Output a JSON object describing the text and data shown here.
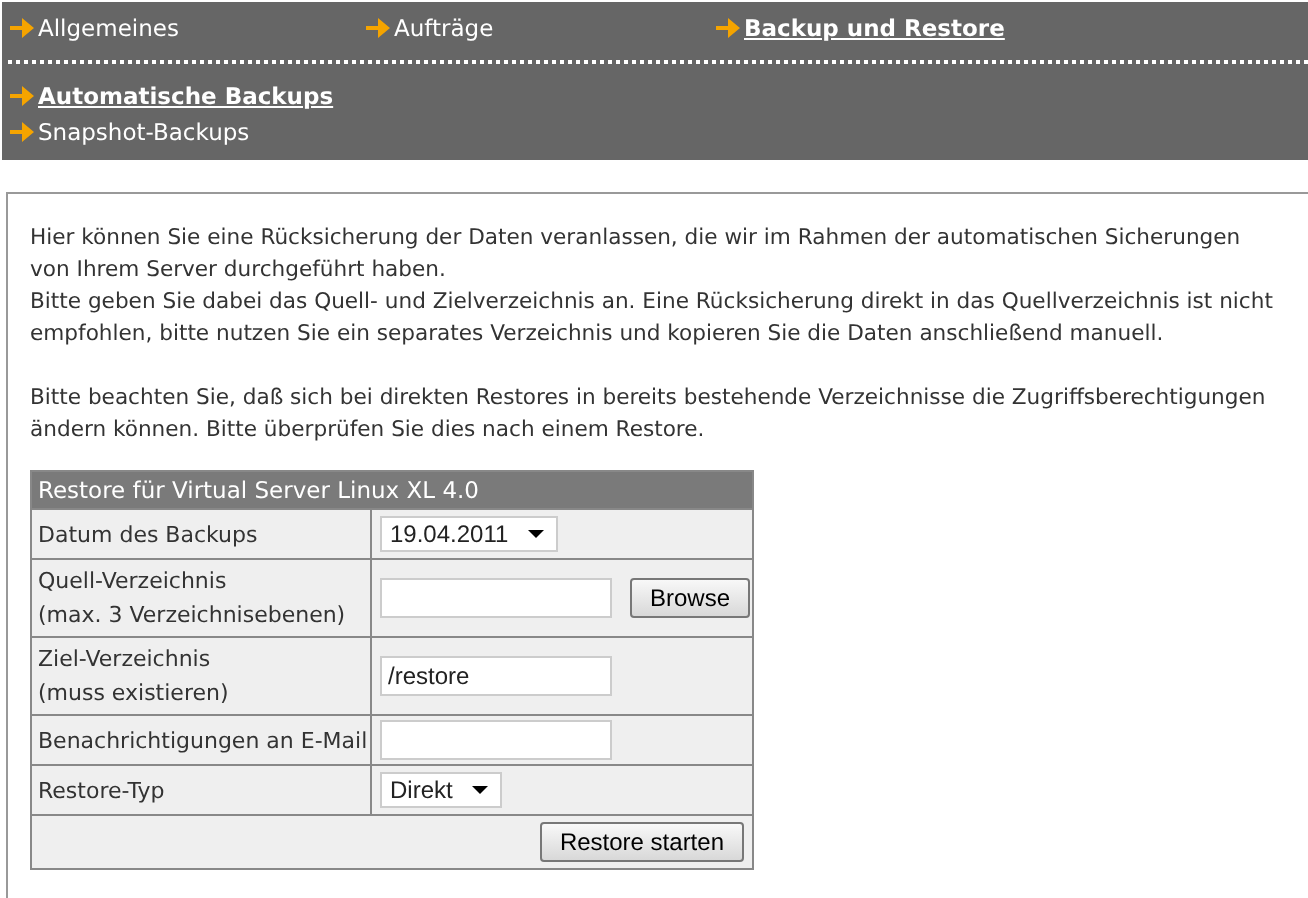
{
  "main_nav": [
    {
      "label": "Allgemeines",
      "selected": false
    },
    {
      "label": "Aufträge",
      "selected": false
    },
    {
      "label": "Backup und Restore",
      "selected": true
    }
  ],
  "sub_nav": [
    {
      "label": "Automatische Backups",
      "selected": true
    },
    {
      "label": "Snapshot-Backups",
      "selected": false
    }
  ],
  "paragraphs": [
    [
      "Hier können Sie eine Rücksicherung der Daten veranlassen, die wir im Rahmen der automatischen Sicherungen",
      "von Ihrem Server durchgeführt haben."
    ],
    [
      "Bitte geben Sie dabei das Quell- und Zielverzeichnis an. Eine Rücksicherung direkt in das Quellverzeichnis ist nicht",
      "empfohlen, bitte nutzen Sie ein separates Verzeichnis und kopieren Sie die Daten anschließend manuell."
    ],
    [
      "Bitte beachten Sie, daß sich bei direkten Restores in bereits bestehende Verzeichnisse die Zugriffsberechtigungen",
      "ändern können. Bitte überprüfen Sie dies nach einem Restore."
    ]
  ],
  "form": {
    "title": "Restore für Virtual Server Linux XL 4.0",
    "rows": [
      {
        "kind": "select",
        "label": [
          "Datum des Backups"
        ],
        "value": "19.04.2011"
      },
      {
        "kind": "browse",
        "label": [
          "Quell-Verzeichnis",
          "(max. 3 Verzeichnisebenen)"
        ],
        "button": "Browse"
      },
      {
        "kind": "input",
        "label": [
          "Ziel-Verzeichnis",
          "(muss existieren)"
        ],
        "value": "/restore"
      },
      {
        "kind": "input",
        "label": [
          "Benachrichtigungen an E-Mail"
        ]
      },
      {
        "kind": "select",
        "label": [
          "Restore-Typ"
        ],
        "value": "Direkt"
      }
    ],
    "submit": "Restore starten"
  }
}
